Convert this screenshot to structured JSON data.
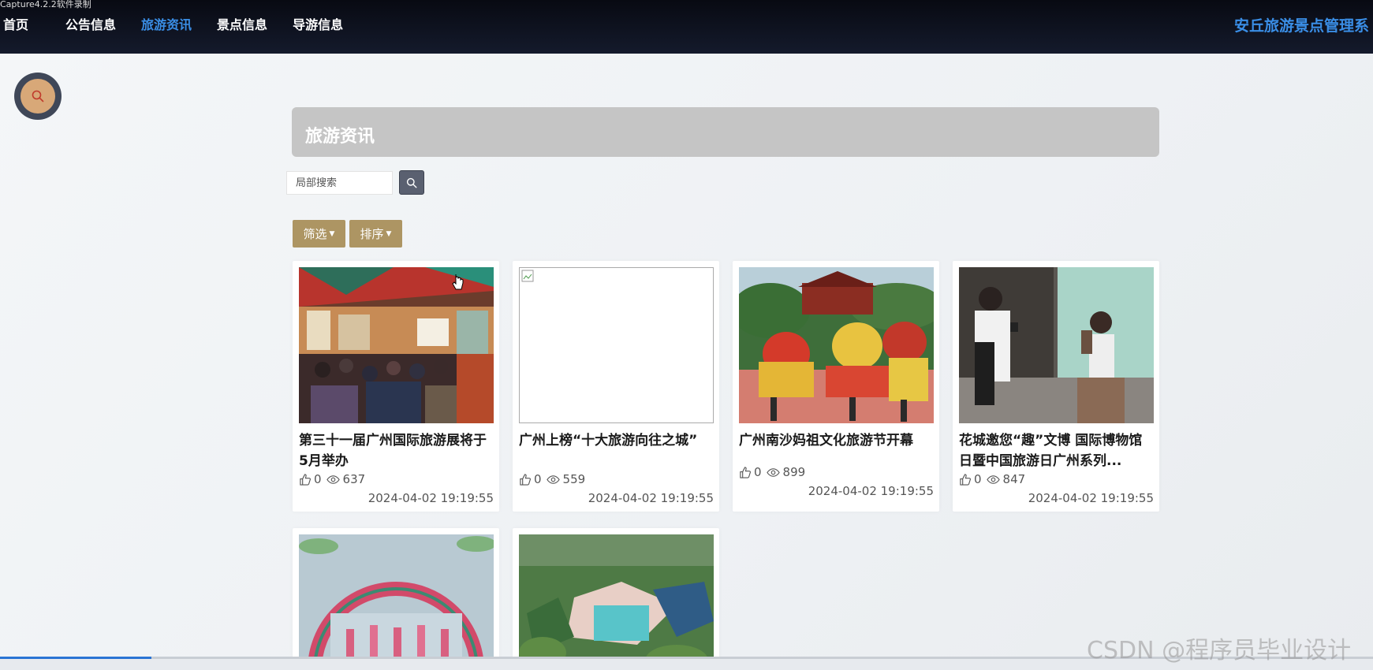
{
  "capture_label": "Capture4.2.2软件录制",
  "nav": {
    "items": [
      {
        "label": "首页",
        "active": false
      },
      {
        "label": "公告信息",
        "active": false
      },
      {
        "label": "旅游资讯",
        "active": true
      },
      {
        "label": "景点信息",
        "active": false
      },
      {
        "label": "导游信息",
        "active": false
      }
    ],
    "site_title": "安丘旅游景点管理系"
  },
  "section": {
    "title": "旅游资讯"
  },
  "search": {
    "placeholder": "局部搜索",
    "value": ""
  },
  "filter_label": "筛选",
  "sort_label": "排序",
  "cards": [
    {
      "title": "第三十一届广州国际旅游展将于5月举办",
      "likes": "0",
      "views": "637",
      "date": "2024-04-02 19:19:55",
      "image": "photo"
    },
    {
      "title": "广州上榜“十大旅游向往之城”",
      "likes": "0",
      "views": "559",
      "date": "2024-04-02 19:19:55",
      "image": "broken"
    },
    {
      "title": "广州南沙妈祖文化旅游节开幕",
      "likes": "0",
      "views": "899",
      "date": "2024-04-02 19:19:55",
      "image": "photo"
    },
    {
      "title": "花城邀您“趣”文博 国际博物馆日暨中国旅游日广州系列...",
      "likes": "0",
      "views": "847",
      "date": "2024-04-02 19:19:55",
      "image": "photo"
    },
    {
      "image": "photo"
    },
    {
      "image": "photo"
    }
  ],
  "scroll_progress": 0.11,
  "watermark": "CSDN @程序员毕业设计",
  "colors": {
    "topbar": "#0d1220",
    "nav_active": "#3a8ee6",
    "section_header": "#c5c5c5",
    "dropdown_button": "#ad9563",
    "search_button": "#5a6070"
  },
  "icons": {
    "search": "search-icon",
    "like": "thumbs-up-icon",
    "views": "eye-icon",
    "dropdown": "caret-down-icon"
  }
}
